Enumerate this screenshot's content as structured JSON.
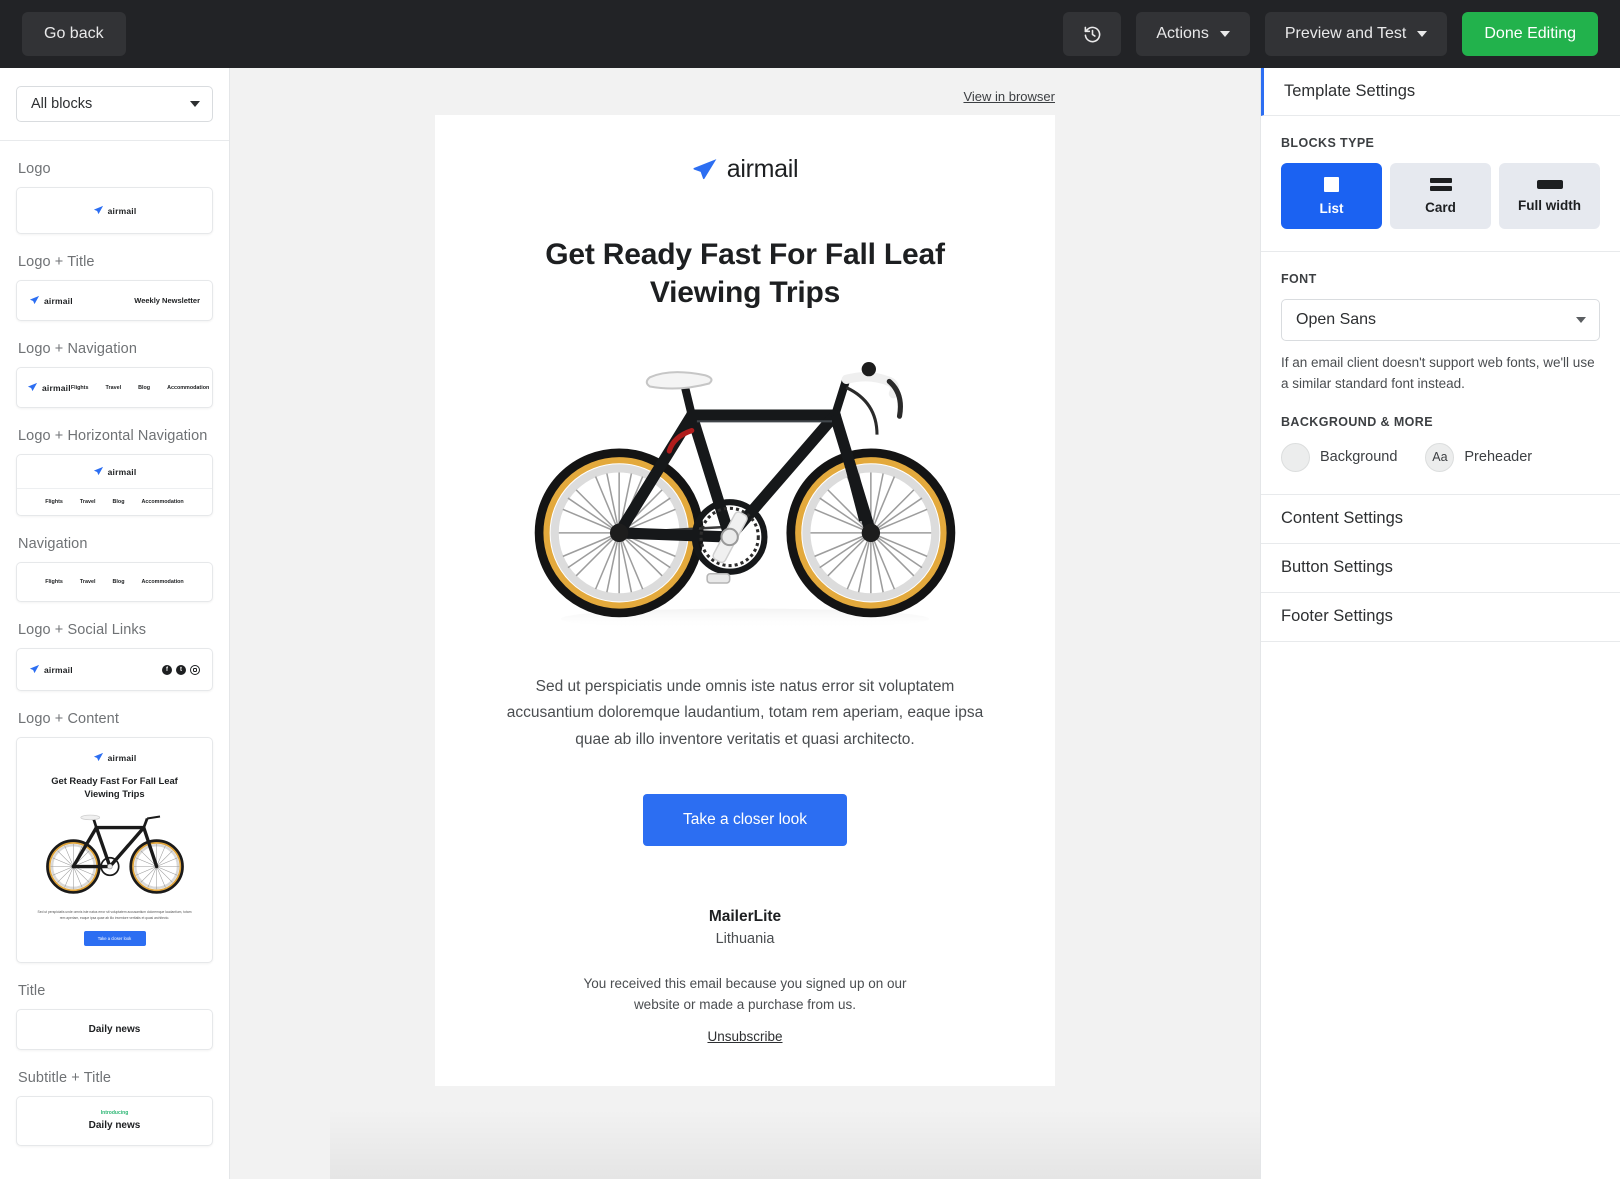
{
  "topbar": {
    "go_back": "Go back",
    "history_icon": "history-clock-icon",
    "actions": "Actions",
    "preview_and_test": "Preview and Test",
    "done_editing": "Done Editing",
    "accent_green": "#22b24c",
    "bg": "#222326"
  },
  "sidebar": {
    "filter_value": "All blocks",
    "blocks": [
      {
        "label": "Logo",
        "type": "logo"
      },
      {
        "label": "Logo + Title",
        "type": "logo_title",
        "title": "Weekly Newsletter"
      },
      {
        "label": "Logo + Navigation",
        "type": "logo_nav"
      },
      {
        "label": "Logo + Horizontal Navigation",
        "type": "logo_hnav"
      },
      {
        "label": "Navigation",
        "type": "nav"
      },
      {
        "label": "Logo + Social Links",
        "type": "logo_social"
      },
      {
        "label": "Logo + Content",
        "type": "logo_content"
      },
      {
        "label": "Title",
        "type": "title",
        "title": "Daily news"
      },
      {
        "label": "Subtitle + Title",
        "type": "sub_title",
        "kicker": "Introducing",
        "title": "Daily news"
      }
    ],
    "nav_items": [
      "Flights",
      "Travel",
      "Blog",
      "Accommodation"
    ],
    "social_icons": [
      "facebook-icon",
      "twitter-icon",
      "instagram-icon"
    ],
    "logo_word": "airmail"
  },
  "canvas": {
    "view_in_browser": "View in browser",
    "email": {
      "logo_word": "airmail",
      "logo_icon": "paper-plane-icon",
      "headline": "Get Ready Fast For Fall Leaf Viewing Trips",
      "hero_image": "bicycle-photo",
      "paragraph": "Sed ut perspiciatis unde omnis iste natus error sit voluptatem accusantium doloremque laudantium, totam rem aperiam, eaque ipsa quae ab illo inventore veritatis et quasi architecto.",
      "cta_label": "Take a closer look",
      "cta_color": "#2c6ef2",
      "footer_brand": "MailerLite",
      "footer_country": "Lithuania",
      "footer_note": "You received this email because you signed up on our website or made a purchase from us.",
      "unsubscribe": "Unsubscribe"
    }
  },
  "right_panel": {
    "header": "Template Settings",
    "blocks_type_caption": "BLOCKS TYPE",
    "blocks_type": [
      {
        "label": "List",
        "icon": "square-icon",
        "active": true
      },
      {
        "label": "Card",
        "icon": "two-bars-icon",
        "active": false
      },
      {
        "label": "Full width",
        "icon": "wide-bar-icon",
        "active": false
      }
    ],
    "font_caption": "FONT",
    "font_value": "Open Sans",
    "font_hint": "If an email client doesn't support web fonts, we'll use a similar standard font instead.",
    "background_caption": "BACKGROUND & MORE",
    "background_label": "Background",
    "preheader_label": "Preheader",
    "preheader_swatch_text": "Aa",
    "rows": [
      "Content Settings",
      "Button Settings",
      "Footer Settings"
    ],
    "active_accent": "#2c6ef2"
  }
}
